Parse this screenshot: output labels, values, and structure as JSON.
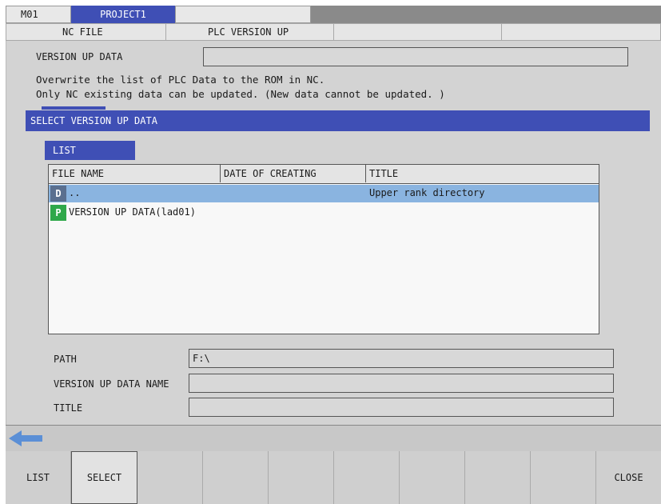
{
  "header": {
    "machine": "M01",
    "project": "PROJECT1",
    "tabs": [
      "NC FILE",
      "PLC VERSION UP"
    ]
  },
  "version_up": {
    "label": "VERSION UP DATA",
    "value": "",
    "desc_line1": "Overwrite the list of PLC Data to the ROM in NC.",
    "desc_line2": "Only NC existing data can be updated. (New data cannot be updated. )"
  },
  "dialog": {
    "title": "SELECT VERSION UP DATA",
    "list_tab": "LIST",
    "columns": [
      "FILE NAME",
      "DATE OF CREATING",
      "TITLE"
    ],
    "rows": [
      {
        "type": "D",
        "name": "..",
        "date": "",
        "title": "Upper rank directory",
        "selected": true
      },
      {
        "type": "P",
        "name": "VERSION UP DATA(lad01)",
        "date": "",
        "title": "",
        "selected": false
      }
    ],
    "path_label": "PATH",
    "path_value": "F:\\",
    "name_label": "VERSION UP DATA NAME",
    "name_value": "",
    "title_label": "TITLE",
    "title_value": ""
  },
  "colors": {
    "accent": "#3f4fb5",
    "selected_row": "#8ab4e0",
    "badge_dir": "#5a6f8f",
    "badge_plc": "#2fa84a",
    "arrow": "#5b8fd6"
  },
  "softkeys": [
    "LIST",
    "SELECT",
    "",
    "",
    "",
    "",
    "",
    "",
    "",
    "CLOSE"
  ]
}
